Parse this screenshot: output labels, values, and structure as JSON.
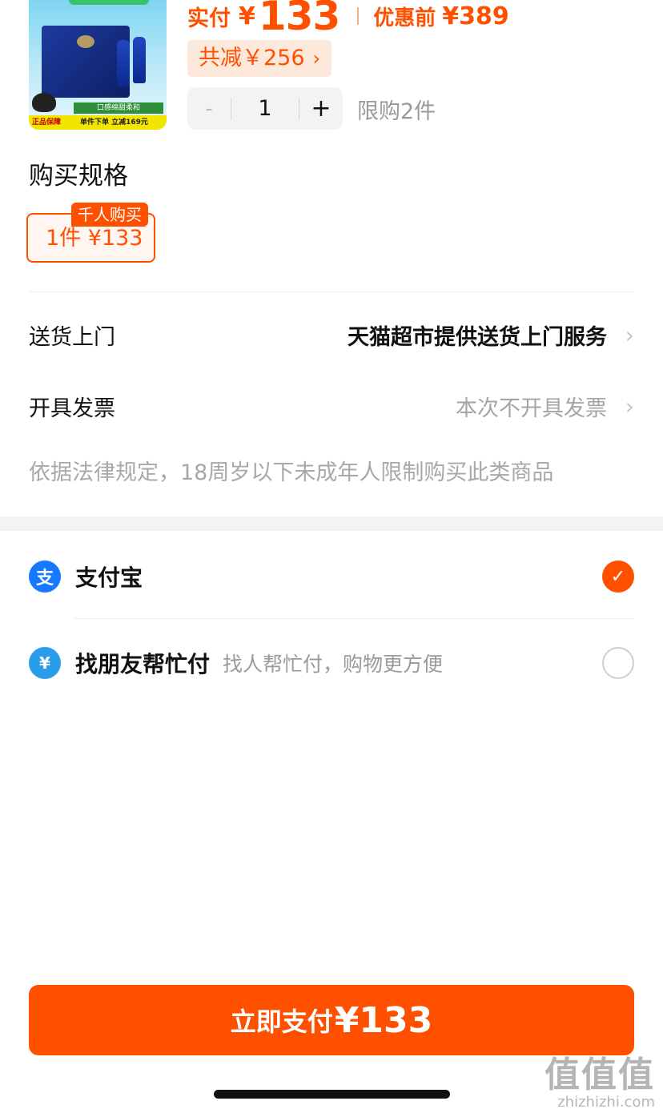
{
  "product": {
    "image_badge_left": "正品保障",
    "image_badge_right": "单件下单 立减169元",
    "image_label": "口感绵甜柔和",
    "pay_label": "实付",
    "pay_currency": "¥",
    "pay_value": "133",
    "orig_label": "优惠前",
    "orig_price": "¥389",
    "discount_text": "共减￥256",
    "discount_chevron": "›",
    "quantity": "1",
    "minus": "-",
    "plus": "+",
    "limit_text": "限购2件"
  },
  "spec": {
    "title": "购买规格",
    "option_label": "1件  ¥133",
    "option_badge": "千人购买"
  },
  "rows": {
    "delivery_label": "送货上门",
    "delivery_value": "天猫超市提供送货上门服务",
    "invoice_label": "开具发票",
    "invoice_value": "本次不开具发票",
    "chevron": "›"
  },
  "legal_notice": "依据法律规定，18周岁以下未成年人限制购买此类商品",
  "payment": {
    "alipay_name": "支付宝",
    "alipay_icon": "支",
    "alipay_selected": true,
    "friend_name": "找朋友帮忙付",
    "friend_desc": "找人帮忙付，购物更方便",
    "friend_icon": "¥",
    "check": "✓"
  },
  "pay_button": {
    "label": "立即支付",
    "amount": "¥133"
  },
  "watermark": {
    "big": "值值值",
    "small": "zhizhizhi.com"
  },
  "colors": {
    "accent": "#ff5000",
    "alipay_blue": "#1677ff"
  }
}
